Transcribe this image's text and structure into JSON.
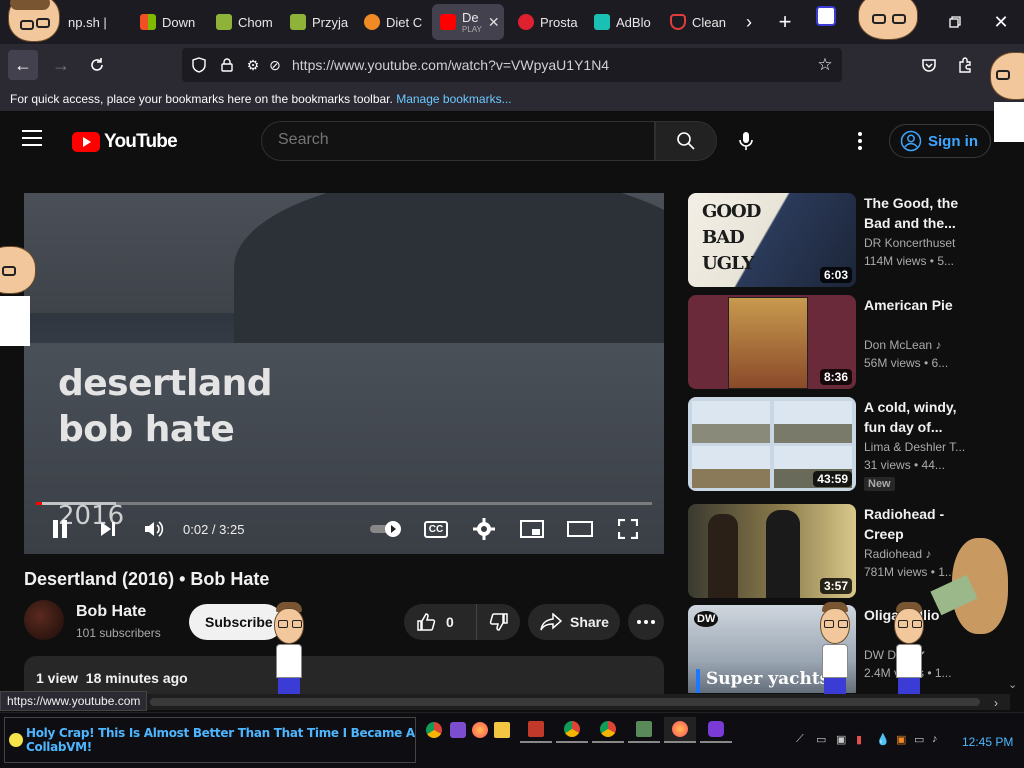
{
  "browser": {
    "tabs": [
      {
        "label": "np.sh |",
        "color": "#888"
      },
      {
        "label": "Down",
        "color": "#f25022"
      },
      {
        "label": "Chom",
        "color": "#8fb339"
      },
      {
        "label": "Przyja",
        "color": "#8fb339"
      },
      {
        "label": "Diet C",
        "color": "#f08a24"
      },
      {
        "label": "De",
        "sublabel": "PLAY",
        "color": "#ff0000",
        "active": true
      },
      {
        "label": "Prosta",
        "color": "#e0202e"
      },
      {
        "label": "AdBlo",
        "color": "#19c0b3"
      },
      {
        "label": "Clean",
        "color": "#e03d3d"
      }
    ],
    "tab_close": "✕",
    "url": "https://www.youtube.com/watch?v=VWpyaU1Y1N4",
    "bookmarks_hint": "For quick access, place your bookmarks here on the bookmarks toolbar.",
    "bookmarks_link": "Manage bookmarks..."
  },
  "youtube": {
    "logo_text": "YouTube",
    "search_placeholder": "Search",
    "sign_in": "Sign in"
  },
  "player": {
    "overlay_line1": "desertland",
    "overlay_line2": "bob hate",
    "overlay_year": "2016",
    "time": "0:02 / 3:25",
    "progress_fraction": 0.01,
    "buffered_fraction": 0.13,
    "cc": "CC"
  },
  "video": {
    "title": "Desertland (2016) • Bob Hate",
    "channel": "Bob Hate",
    "subscribers": "101 subscribers",
    "subscribe_label": "Subscribe",
    "likes": "0",
    "share_label": "Share",
    "meta": "1 view  18 minutes ago"
  },
  "recommendations": [
    {
      "title": "The Good, the Bad and the...",
      "channel": "DR Koncerthuset",
      "stats": "114M views  • 5...",
      "duration": "6:03",
      "thumb_text": "GOOD BAD UGLY",
      "music": false,
      "verified": false
    },
    {
      "title": "American Pie",
      "channel": "Don McLean",
      "stats": "56M views  • 6...",
      "duration": "8:36",
      "music": true,
      "verified": false
    },
    {
      "title": "A cold, windy, fun day of...",
      "channel": "Lima & Deshler T...",
      "stats": "31 views  • 44...",
      "duration": "43:59",
      "badge": "New",
      "music": false,
      "verified": false
    },
    {
      "title": "Radiohead - Creep",
      "channel": "Radiohead",
      "stats": "781M views  • 1...",
      "duration": "3:57",
      "music": true,
      "verified": false
    },
    {
      "title": "Oliga millio",
      "channel": "DW Do...",
      "stats": "2.4M views  • 1...",
      "thumb_text": "Super yachts",
      "thumb_tag": "DW",
      "music": false,
      "verified": true
    }
  ],
  "status_url": "https://www.youtube.com",
  "taskbar": {
    "banner": "Holy Crap! This Is Almost Better Than That Time I Became A CollabVM!",
    "clock": "12:45 PM"
  }
}
